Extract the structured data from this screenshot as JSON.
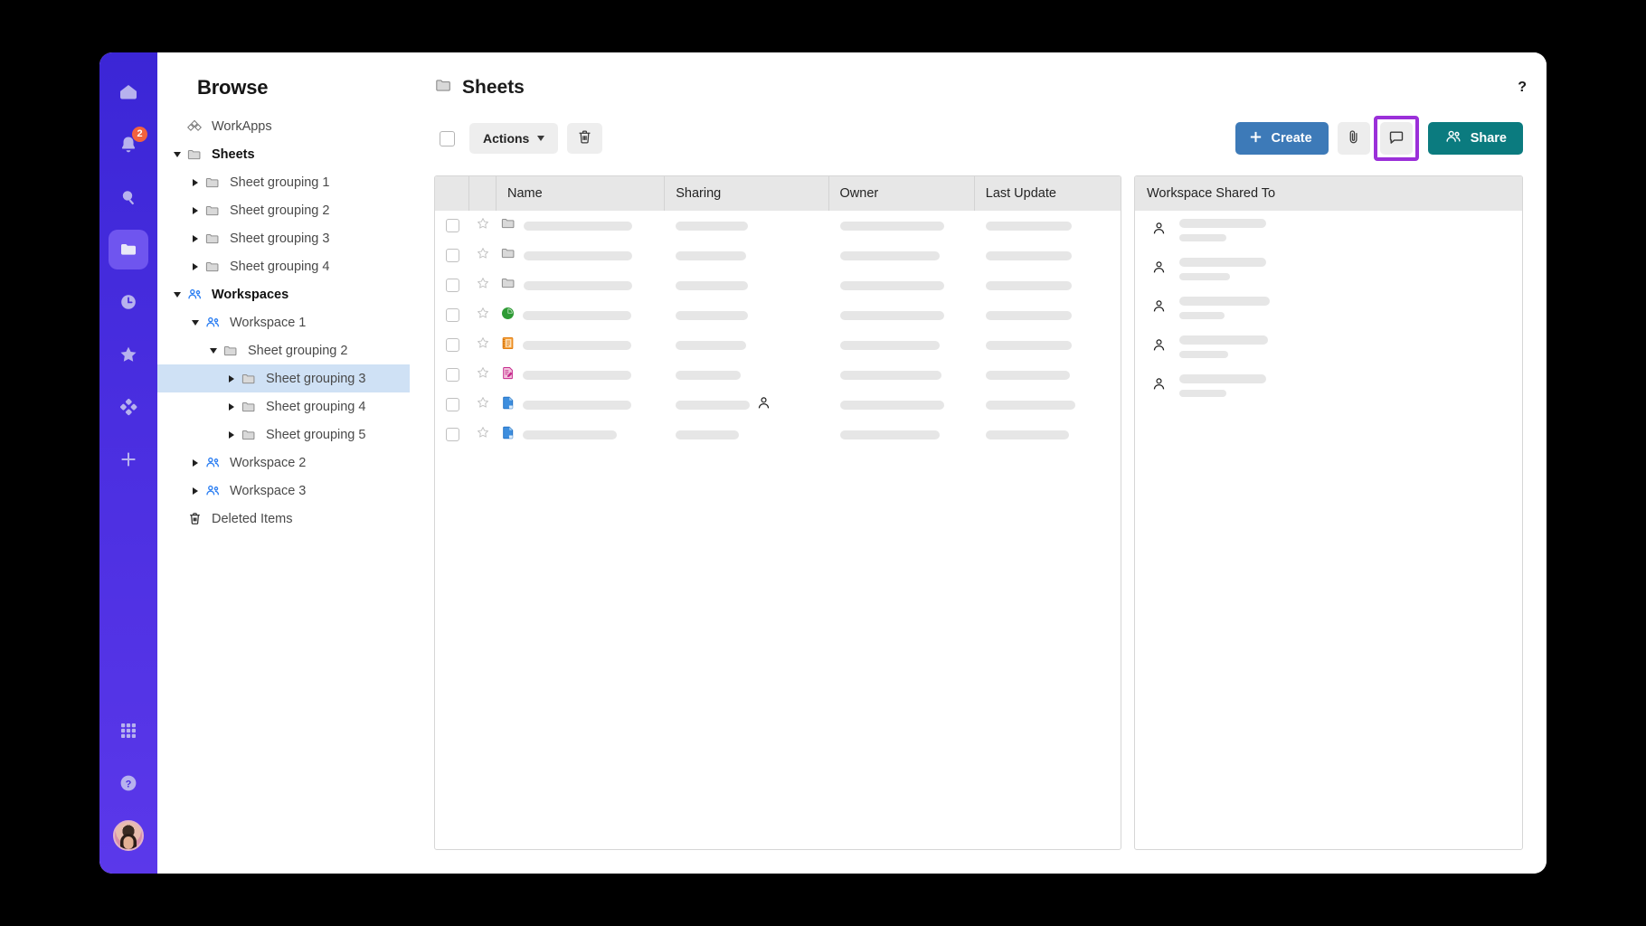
{
  "rail": {
    "items": [
      {
        "name": "home-icon",
        "badge": null
      },
      {
        "name": "notifications-bell-icon",
        "badge": "2"
      },
      {
        "name": "search-icon",
        "badge": null
      },
      {
        "name": "browse-folder-icon",
        "badge": null
      },
      {
        "name": "recents-clock-icon",
        "badge": null
      },
      {
        "name": "favorites-star-icon",
        "badge": null
      },
      {
        "name": "workapps-diamond-icon",
        "badge": null
      },
      {
        "name": "create-plus-icon",
        "badge": null
      }
    ],
    "bottom": [
      {
        "name": "app-grid-icon"
      },
      {
        "name": "help-question-icon"
      },
      {
        "name": "user-avatar"
      }
    ]
  },
  "sidebar": {
    "title": "Browse",
    "tree": [
      {
        "label": "WorkApps",
        "indent": 0,
        "caret": "none",
        "icon": "workapps-icon",
        "bold": false,
        "selected": false
      },
      {
        "label": "Sheets",
        "indent": 0,
        "caret": "expanded",
        "icon": "folder-icon",
        "bold": true,
        "selected": false
      },
      {
        "label": "Sheet grouping 1",
        "indent": 1,
        "caret": "collapsed",
        "icon": "folder-icon",
        "bold": false,
        "selected": false
      },
      {
        "label": "Sheet grouping 2",
        "indent": 1,
        "caret": "collapsed",
        "icon": "folder-icon",
        "bold": false,
        "selected": false
      },
      {
        "label": "Sheet grouping 3",
        "indent": 1,
        "caret": "collapsed",
        "icon": "folder-icon",
        "bold": false,
        "selected": false
      },
      {
        "label": "Sheet grouping 4",
        "indent": 1,
        "caret": "collapsed",
        "icon": "folder-icon",
        "bold": false,
        "selected": false
      },
      {
        "label": "Workspaces",
        "indent": 0,
        "caret": "expanded",
        "icon": "workspace-icon",
        "bold": true,
        "selected": false
      },
      {
        "label": "Workspace 1",
        "indent": 1,
        "caret": "expanded",
        "icon": "workspace-icon",
        "bold": false,
        "selected": false
      },
      {
        "label": "Sheet grouping 2",
        "indent": 2,
        "caret": "expanded",
        "icon": "folder-icon",
        "bold": false,
        "selected": false
      },
      {
        "label": "Sheet grouping 3",
        "indent": 3,
        "caret": "collapsed",
        "icon": "folder-icon",
        "bold": false,
        "selected": true
      },
      {
        "label": "Sheet grouping 4",
        "indent": 3,
        "caret": "collapsed",
        "icon": "folder-icon",
        "bold": false,
        "selected": false
      },
      {
        "label": "Sheet grouping 5",
        "indent": 3,
        "caret": "collapsed",
        "icon": "folder-icon",
        "bold": false,
        "selected": false
      },
      {
        "label": "Workspace 2",
        "indent": 1,
        "caret": "collapsed",
        "icon": "workspace-icon",
        "bold": false,
        "selected": false
      },
      {
        "label": "Workspace 3",
        "indent": 1,
        "caret": "collapsed",
        "icon": "workspace-icon",
        "bold": false,
        "selected": false
      },
      {
        "label": "Deleted Items",
        "indent": 0,
        "caret": "none",
        "icon": "trash-icon",
        "bold": false,
        "selected": false
      }
    ]
  },
  "header": {
    "title": "Sheets",
    "folder_icon": "folder-icon",
    "help_label": "?"
  },
  "toolbar": {
    "select_all_checkbox": false,
    "actions_label": "Actions",
    "delete_icon": "trash-icon",
    "create_label": "Create",
    "create_icon": "plus-icon",
    "attach_icon": "paperclip-icon",
    "comment_icon": "comment-icon",
    "comment_highlighted": true,
    "share_label": "Share",
    "share_icon": "people-icon"
  },
  "table": {
    "columns": [
      "Name",
      "Sharing",
      "Owner",
      "Last Update"
    ],
    "rows": [
      {
        "icon": "folder-icon",
        "name_w": 120,
        "share_w": 80,
        "owner_w": 115,
        "update_w": 95,
        "shared_person": false
      },
      {
        "icon": "folder-icon",
        "name_w": 120,
        "share_w": 78,
        "owner_w": 110,
        "update_w": 95,
        "shared_person": false
      },
      {
        "icon": "folder-icon",
        "name_w": 120,
        "share_w": 80,
        "owner_w": 115,
        "update_w": 95,
        "shared_person": false
      },
      {
        "icon": "dashboard-icon",
        "name_w": 120,
        "share_w": 80,
        "owner_w": 115,
        "update_w": 95,
        "shared_person": false
      },
      {
        "icon": "report-icon",
        "name_w": 120,
        "share_w": 78,
        "owner_w": 110,
        "update_w": 95,
        "shared_person": false
      },
      {
        "icon": "form-icon",
        "name_w": 120,
        "share_w": 72,
        "owner_w": 112,
        "update_w": 93,
        "shared_person": false
      },
      {
        "icon": "sheet-icon",
        "name_w": 120,
        "share_w": 82,
        "owner_w": 115,
        "update_w": 99,
        "shared_person": true
      },
      {
        "icon": "sheet-icon",
        "name_w": 104,
        "share_w": 70,
        "owner_w": 110,
        "update_w": 92,
        "shared_person": false
      }
    ]
  },
  "right_panel": {
    "title": "Workspace Shared To",
    "rows": [
      {
        "icon": "person-icon",
        "line1_w": 96,
        "line2_w": 52
      },
      {
        "icon": "person-icon",
        "line1_w": 96,
        "line2_w": 56
      },
      {
        "icon": "person-icon",
        "line1_w": 100,
        "line2_w": 50
      },
      {
        "icon": "person-icon",
        "line1_w": 98,
        "line2_w": 54
      },
      {
        "icon": "person-icon",
        "line1_w": 96,
        "line2_w": 52
      }
    ]
  },
  "colors": {
    "rail": "#4a2ee0",
    "rail_active": "#6f55ef",
    "badge": "#f2623e",
    "create_button": "#3d7ab8",
    "share_button": "#0b7b7f",
    "highlight_border": "#9b30d9",
    "tree_selected": "#cfe1f5",
    "table_header": "#e7e7e7"
  }
}
